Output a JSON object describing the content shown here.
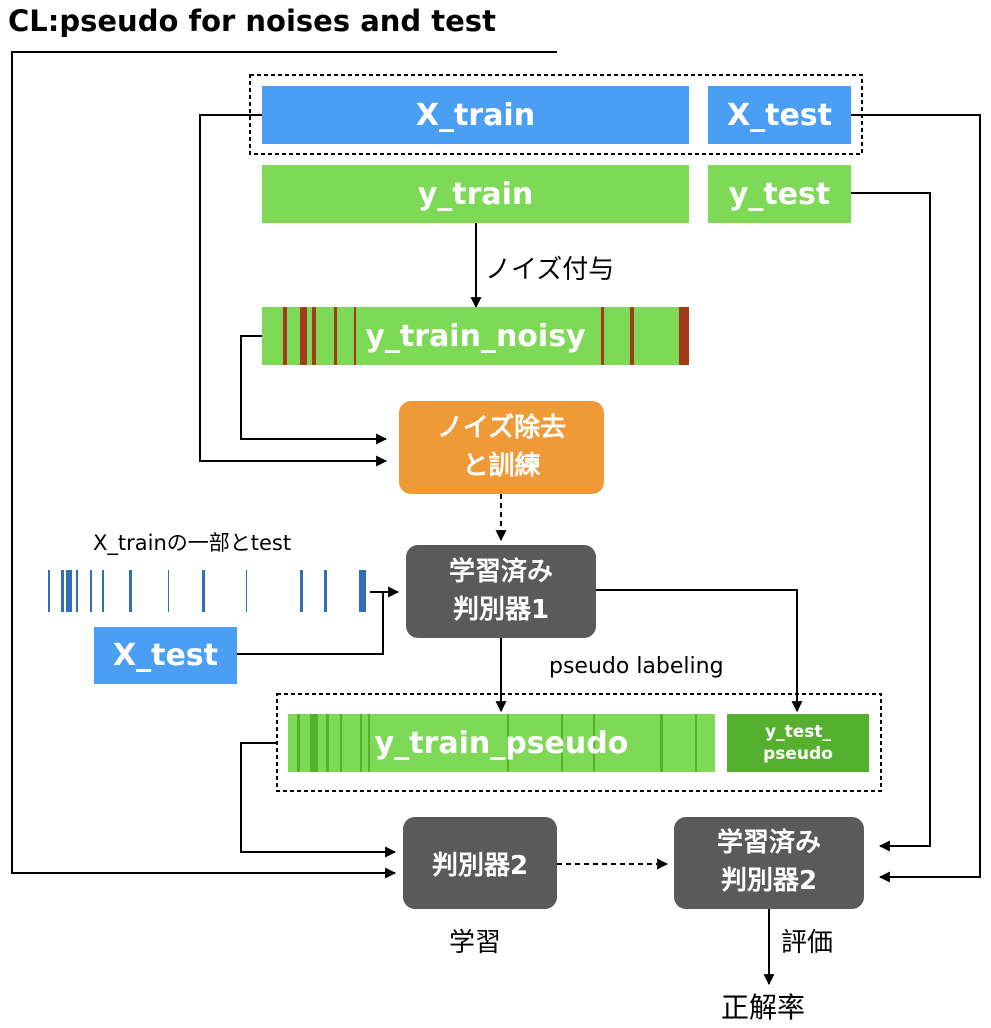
{
  "title": "CL:pseudo for noises and test",
  "boxes": {
    "x_train": "X_train",
    "x_test_top": "X_test",
    "y_train": "y_train",
    "y_test": "y_test",
    "y_train_noisy": "y_train_noisy",
    "denoise_line1": "ノイズ除去",
    "denoise_line2": "と訓練",
    "trained1_line1": "学習済み",
    "trained1_line2": "判別器1",
    "x_test_left": "X_test",
    "y_train_pseudo": "y_train_pseudo",
    "y_test_pseudo_line1": "y_test_",
    "y_test_pseudo_line2": "pseudo",
    "clf2": "判別器2",
    "trained2_line1": "学習済み",
    "trained2_line2": "判別器2"
  },
  "labels": {
    "add_noise": "ノイズ付与",
    "subset_caption": "X_trainの一部とtest",
    "pseudo_labeling": "pseudo labeling",
    "learn": "学習",
    "evaluate": "評価",
    "accuracy": "正解率"
  },
  "colors": {
    "blue": "#4A9FF5",
    "green": "#7ED957",
    "dark_green": "#55B030",
    "noise_red": "#A33A1A",
    "orange": "#F09A37",
    "gray": "#5A5A5A",
    "stripe_blue": "#2F6FB5"
  }
}
